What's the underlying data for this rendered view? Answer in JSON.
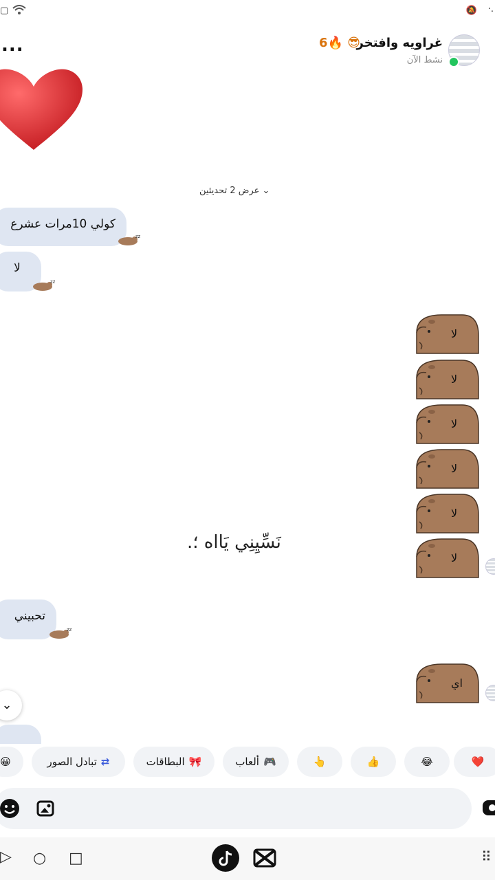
{
  "status": {
    "time": "·.",
    "icons": [
      "battery-icon",
      "wifi-icon",
      "mute-icon"
    ]
  },
  "header": {
    "name": "غراويه وافتخر",
    "emoji": "😎",
    "streak_count": "6",
    "streak_icon": "🔥",
    "active": "نشط الآن",
    "more": "..."
  },
  "thread": {
    "show_replies": "عرض 2 تحديثين",
    "messages_in": [
      "كولي 10مرات عشرع",
      "لا",
      "تحبيني"
    ],
    "stickers_out": [
      "لا",
      "لا",
      "لا",
      "لا",
      "لا",
      "لا",
      "اي"
    ],
    "overlay": "نَسِّيِنِي يَااه ؛."
  },
  "chips": [
    {
      "label": "",
      "icon": "❤️"
    },
    {
      "label": "",
      "icon": "😂"
    },
    {
      "label": "",
      "icon": "👍"
    },
    {
      "label": "",
      "icon": "👆"
    },
    {
      "label": "ألعاب",
      "icon": "🎮"
    },
    {
      "label": "البطاقات",
      "icon": "🎀"
    },
    {
      "label": "تبادل الصور",
      "icon": "⇄"
    },
    {
      "label": "",
      "icon": "😀"
    }
  ],
  "colors": {
    "bubble_in": "#dfe6f2",
    "sticker": "#a77b5a",
    "online": "#22c55e"
  }
}
